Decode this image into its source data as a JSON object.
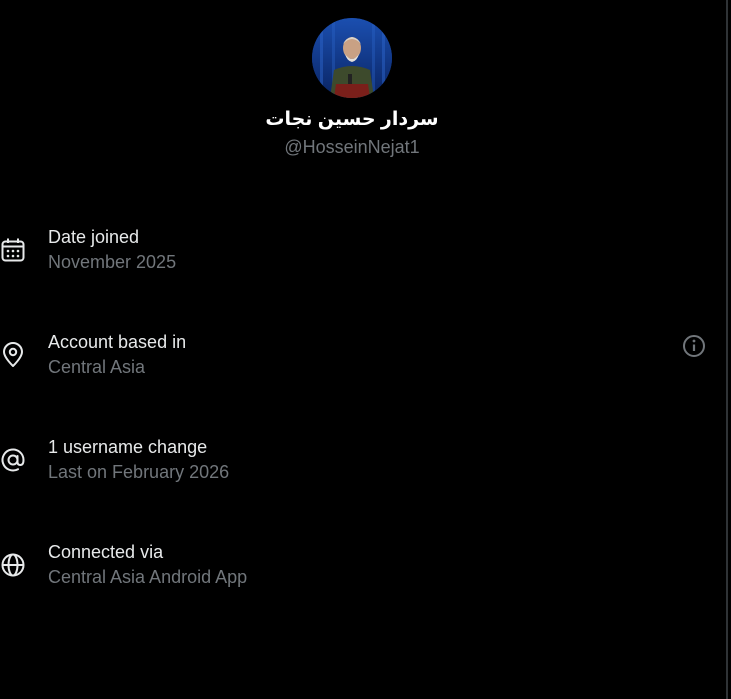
{
  "profile": {
    "display_name": "سردار حسین نجات",
    "handle": "@HosseinNejat1"
  },
  "about_items": [
    {
      "title": "Date joined",
      "subtitle": "November 2025",
      "icon": "calendar-icon"
    },
    {
      "title": "Account based in",
      "subtitle": "Central Asia",
      "icon": "location-pin-icon",
      "action_icon": "info-icon"
    },
    {
      "title": "1 username change",
      "subtitle": "Last on February 2026",
      "icon": "at-sign-icon"
    },
    {
      "title": "Connected via",
      "subtitle": "Central Asia Android App",
      "icon": "globe-icon"
    }
  ],
  "colors": {
    "background": "#000000",
    "primary_text": "#e7e9ea",
    "secondary_text": "#71767b",
    "divider": "#2f3336"
  }
}
